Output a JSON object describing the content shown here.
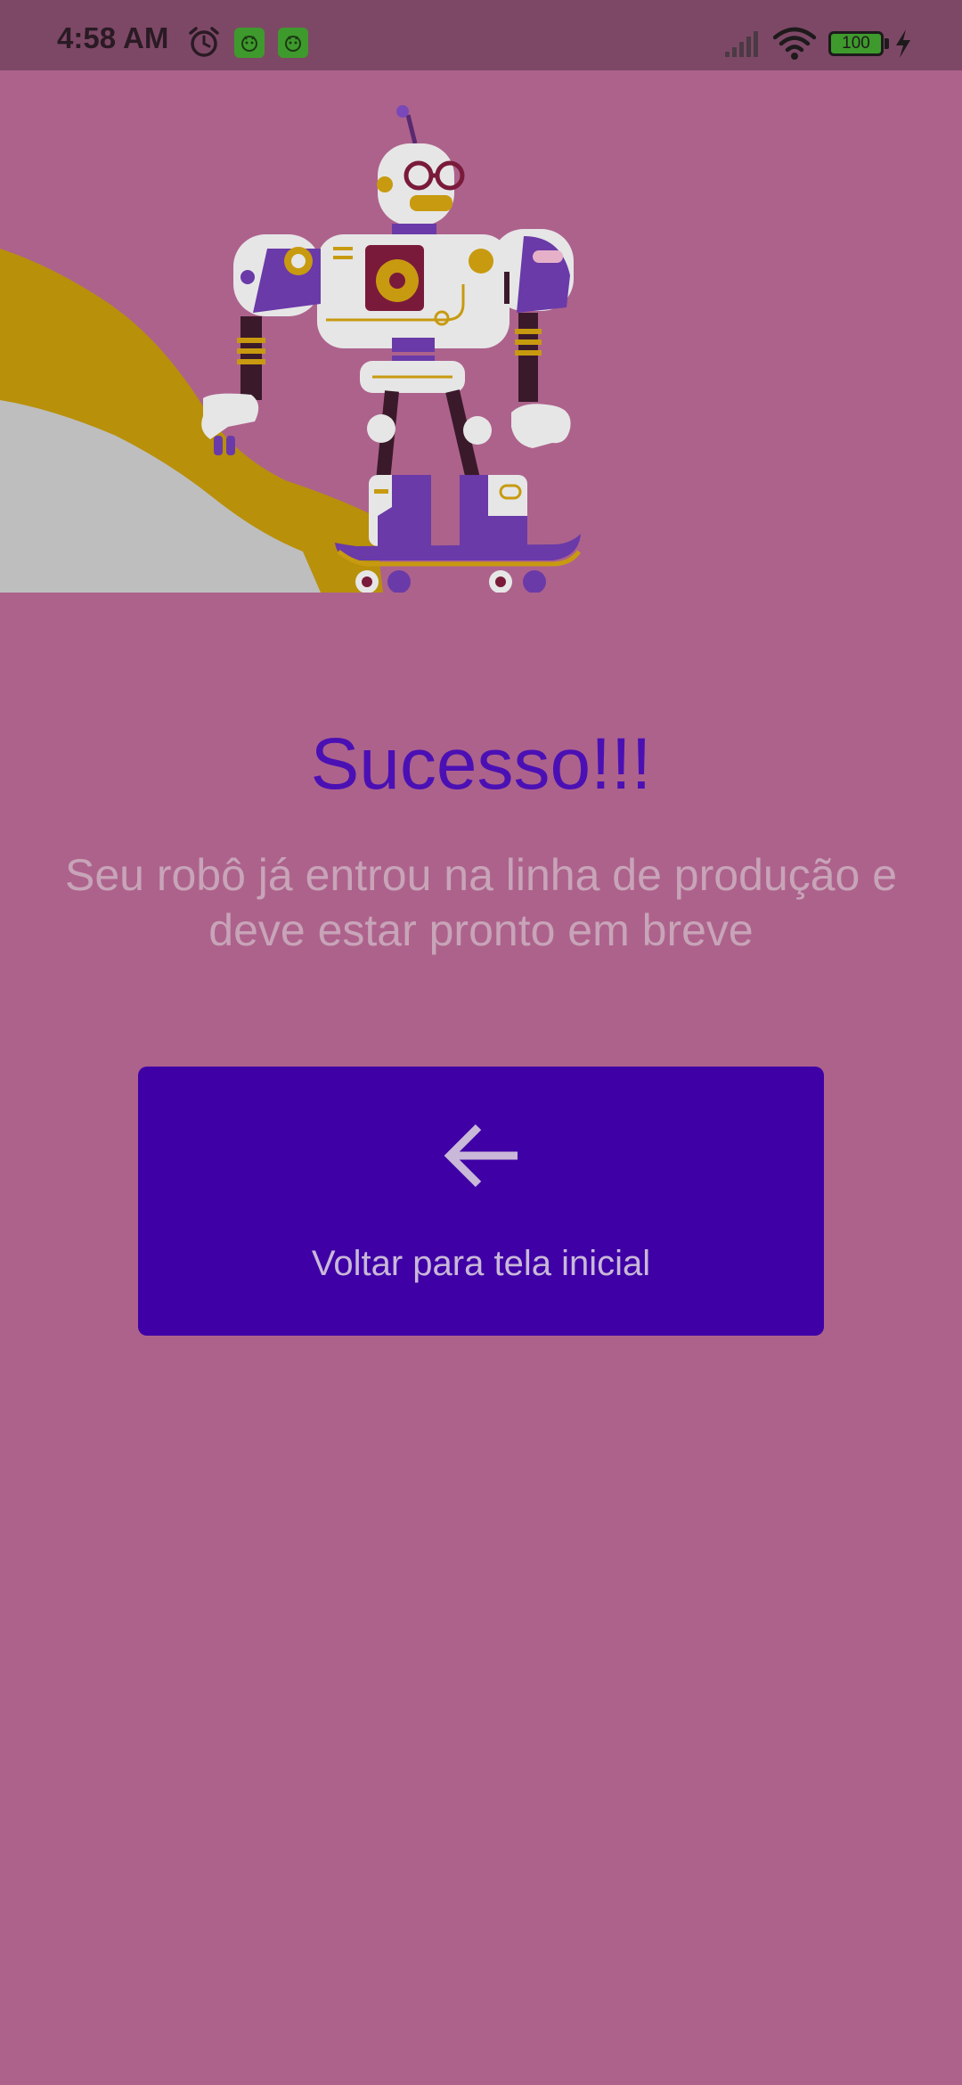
{
  "status_bar": {
    "time": "4:58 AM",
    "battery_level": "100",
    "icons": [
      "alarm-icon",
      "app-notification-icon",
      "app-notification-icon",
      "signal-icon",
      "wifi-icon",
      "battery-icon",
      "charging-icon"
    ]
  },
  "hero": {
    "illustration": "robot-on-skateboard"
  },
  "main": {
    "title": "Sucesso!!!",
    "subtitle_line1": "Seu robô já entrou na linha de produção e",
    "subtitle_line2": "deve estar pronto em breve"
  },
  "back_button": {
    "label": "Voltar para tela inicial",
    "icon": "arrow-left-icon"
  },
  "colors": {
    "background": "#ad628c",
    "status_bar": "#7d4866",
    "title": "#4b10b4",
    "subtitle": "#c8a4b8",
    "button": "#3f00a6",
    "button_text": "#c9b8d8"
  }
}
